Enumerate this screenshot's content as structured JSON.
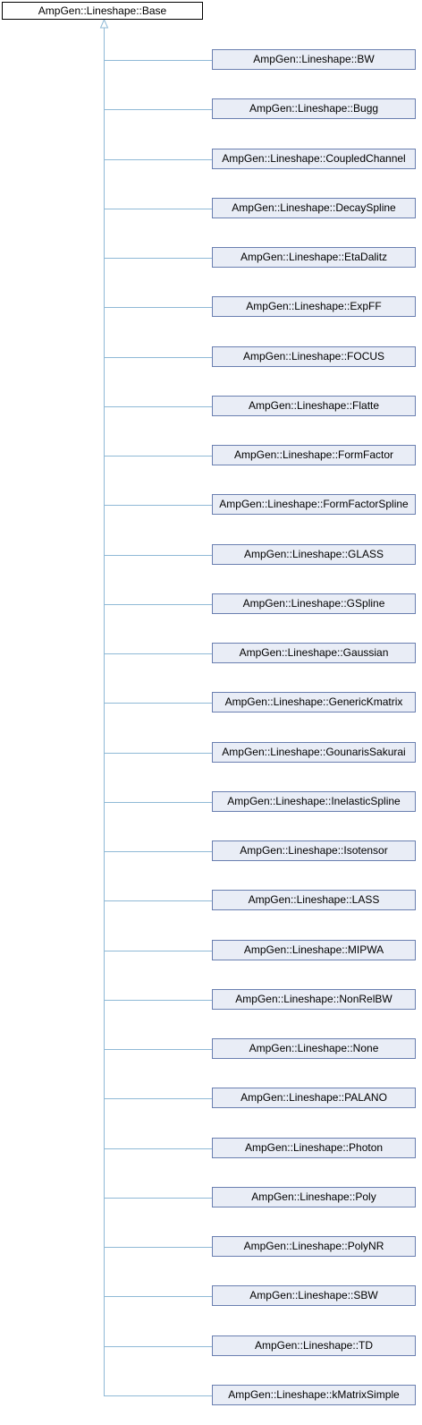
{
  "colors": {
    "edge": "#8fb9d6",
    "child_fill": "#e9edf6",
    "child_border": "#6a7fb0",
    "base_border": "#000000"
  },
  "base_class": "AmpGen::Lineshape::Base",
  "derived_classes": [
    "AmpGen::Lineshape::BW",
    "AmpGen::Lineshape::Bugg",
    "AmpGen::Lineshape::CoupledChannel",
    "AmpGen::Lineshape::DecaySpline",
    "AmpGen::Lineshape::EtaDalitz",
    "AmpGen::Lineshape::ExpFF",
    "AmpGen::Lineshape::FOCUS",
    "AmpGen::Lineshape::Flatte",
    "AmpGen::Lineshape::FormFactor",
    "AmpGen::Lineshape::FormFactorSpline",
    "AmpGen::Lineshape::GLASS",
    "AmpGen::Lineshape::GSpline",
    "AmpGen::Lineshape::Gaussian",
    "AmpGen::Lineshape::GenericKmatrix",
    "AmpGen::Lineshape::GounarisSakurai",
    "AmpGen::Lineshape::InelasticSpline",
    "AmpGen::Lineshape::Isotensor",
    "AmpGen::Lineshape::LASS",
    "AmpGen::Lineshape::MIPWA",
    "AmpGen::Lineshape::NonRelBW",
    "AmpGen::Lineshape::None",
    "AmpGen::Lineshape::PALANO",
    "AmpGen::Lineshape::Photon",
    "AmpGen::Lineshape::Poly",
    "AmpGen::Lineshape::PolyNR",
    "AmpGen::Lineshape::SBW",
    "AmpGen::Lineshape::TD",
    "AmpGen::Lineshape::kMatrixSimple"
  ]
}
